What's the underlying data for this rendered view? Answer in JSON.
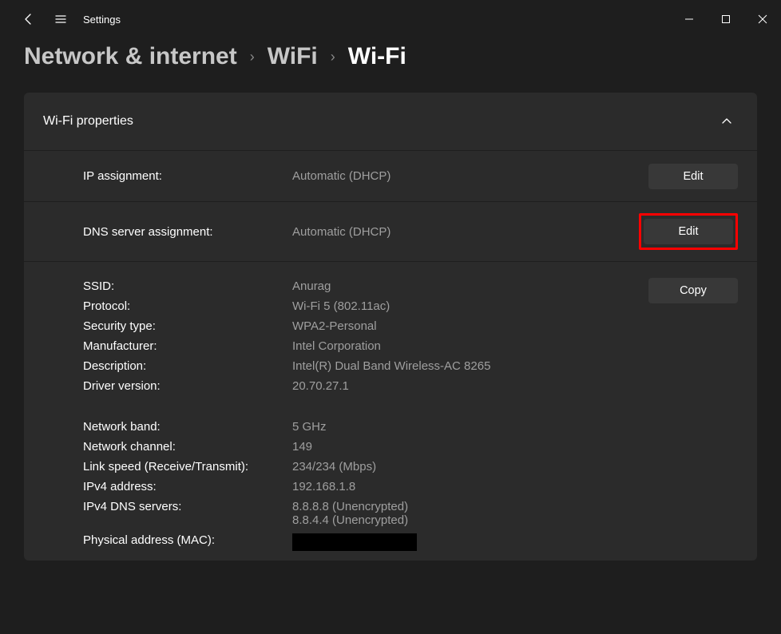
{
  "window": {
    "title": "Settings"
  },
  "breadcrumb": {
    "items": [
      "Network & internet",
      "WiFi"
    ],
    "current": "Wi-Fi"
  },
  "panel": {
    "title": "Wi-Fi properties"
  },
  "rows": {
    "ip_assignment": {
      "label": "IP assignment:",
      "value": "Automatic (DHCP)",
      "button": "Edit"
    },
    "dns_assignment": {
      "label": "DNS server assignment:",
      "value": "Automatic (DHCP)",
      "button": "Edit"
    }
  },
  "details": {
    "copy_button": "Copy",
    "group1": [
      {
        "label": "SSID:",
        "value": "Anurag"
      },
      {
        "label": "Protocol:",
        "value": "Wi-Fi 5 (802.11ac)"
      },
      {
        "label": "Security type:",
        "value": "WPA2-Personal"
      },
      {
        "label": "Manufacturer:",
        "value": "Intel Corporation"
      },
      {
        "label": "Description:",
        "value": "Intel(R) Dual Band Wireless-AC 8265"
      },
      {
        "label": "Driver version:",
        "value": "20.70.27.1"
      }
    ],
    "group2": [
      {
        "label": "Network band:",
        "value": "5 GHz"
      },
      {
        "label": "Network channel:",
        "value": "149"
      },
      {
        "label": "Link speed (Receive/Transmit):",
        "value": "234/234 (Mbps)"
      },
      {
        "label": "IPv4 address:",
        "value": "192.168.1.8"
      },
      {
        "label": "IPv4 DNS servers:",
        "value": "8.8.8.8 (Unencrypted)",
        "value2": "8.8.4.4 (Unencrypted)"
      },
      {
        "label": "Physical address (MAC):",
        "redacted": true
      }
    ]
  }
}
